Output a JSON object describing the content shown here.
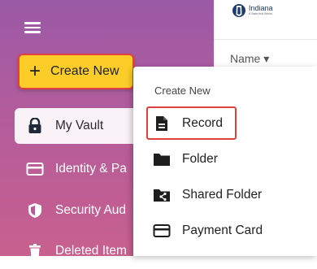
{
  "sidebar": {
    "create_new_label": "Create New",
    "items": [
      {
        "label": "My Vault",
        "icon": "lock-icon"
      },
      {
        "label": "Identity & Pa",
        "icon": "card-icon"
      },
      {
        "label": "Security Aud",
        "icon": "shield-icon"
      },
      {
        "label": "Deleted Item",
        "icon": "trash-icon"
      }
    ]
  },
  "header": {
    "logo_text": "Indiana",
    "logo_subtext": "A State that Works"
  },
  "main": {
    "column_header": "Name ▾"
  },
  "dropdown": {
    "title": "Create New",
    "items": [
      {
        "label": "Record",
        "icon": "document-icon"
      },
      {
        "label": "Folder",
        "icon": "folder-icon"
      },
      {
        "label": "Shared Folder",
        "icon": "shared-folder-icon"
      },
      {
        "label": "Payment Card",
        "icon": "credit-card-icon"
      }
    ]
  },
  "colors": {
    "accent_yellow": "#fccd29",
    "highlight_red": "#e0413f",
    "sidebar_top": "#9a5aa6",
    "sidebar_bottom": "#c8608e"
  }
}
